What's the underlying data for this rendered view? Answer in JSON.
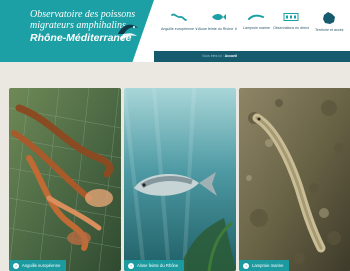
{
  "header": {
    "logo_line1": "Observatoire des poissons",
    "logo_line2": "migrateurs amphihalins",
    "logo_line3": "Rhône-Méditerranée"
  },
  "nav": {
    "items": [
      {
        "label": "Anguille européenne",
        "icon": "eel-icon",
        "has_submenu": true
      },
      {
        "label": "Alose feinte du Rhône",
        "icon": "shad-icon",
        "has_submenu": true
      },
      {
        "label": "Lamproie marine",
        "icon": "lamprey-icon",
        "has_submenu": false
      },
      {
        "label": "Observations en direct",
        "icon": "live-counter-icon",
        "has_submenu": false
      },
      {
        "label": "Territoire et accès",
        "icon": "france-map-icon",
        "has_submenu": false
      }
    ],
    "submenu_chevron": "∨"
  },
  "breadcrumb": {
    "prefix": "Vous êtes ici :",
    "current": "Accueil"
  },
  "cards": [
    {
      "label": "Anguille européenne",
      "arrow": "›"
    },
    {
      "label": "Alose feinte du Rhône",
      "arrow": "›"
    },
    {
      "label": "Lamproie marine",
      "arrow": "›"
    }
  ],
  "colors": {
    "brand_teal": "#1da0a5",
    "dark_teal": "#155a6d",
    "page_bg": "#ebe7e1"
  }
}
